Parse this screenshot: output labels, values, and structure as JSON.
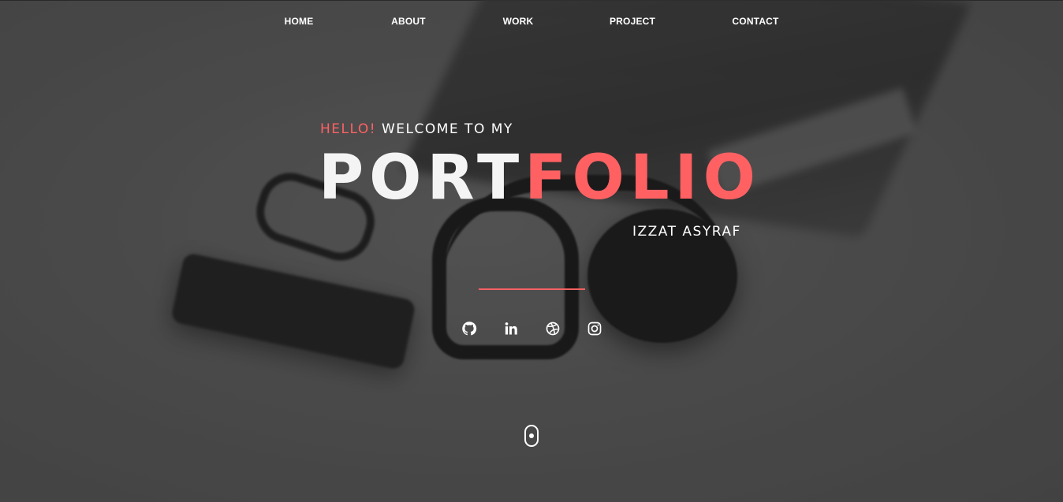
{
  "nav": {
    "items": [
      {
        "label": "HOME"
      },
      {
        "label": "ABOUT"
      },
      {
        "label": "WORK"
      },
      {
        "label": "PROJECT"
      },
      {
        "label": "CONTACT"
      }
    ]
  },
  "hero": {
    "hello": "HELLO!",
    "welcome": "WELCOME TO MY",
    "title_part1": "PORT",
    "title_part2": "FOLIO",
    "name": "IZZAT ASYRAF"
  },
  "social": [
    {
      "icon": "github-icon"
    },
    {
      "icon": "linkedin-icon"
    },
    {
      "icon": "dribbble-icon"
    },
    {
      "icon": "instagram-icon"
    }
  ],
  "colors": {
    "accent": "#ff6163",
    "text": "#ffffff",
    "background": "#575757"
  },
  "scroll_indicator": {
    "icon": "mouse-scroll-icon"
  }
}
